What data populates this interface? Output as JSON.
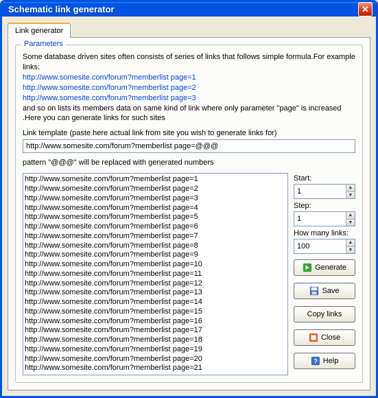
{
  "window": {
    "title": "Schematic link generator"
  },
  "tabs": {
    "main": "Link generator"
  },
  "params": {
    "legend": "Parameters",
    "intro": "Some database driven sites often consists of series of links that follows simple formula.For example links:",
    "example1": "http://www.somesite.com/forum?memberlist page=1",
    "example2": "http://www.somesite.com/forum?memberlist page=2",
    "example3": "http://www.somesite.com/forum?memberlist page=3",
    "explain": "and so on lists its members data on same kind of link where only parameter \"page\" is increased .Here you can generate links for such sites",
    "template_label": "Link template (paste here actual link from site you wish to generate links for)",
    "template_value": "http://www.somesite.com/forum?memberlist page=@@@",
    "pattern_note": "pattern \"@@@\" will be replaced with generated numbers"
  },
  "side": {
    "start_label": "Start:",
    "start_value": "1",
    "step_label": "Step:",
    "step_value": "1",
    "count_label": "How many links:",
    "count_value": "100",
    "generate": "Generate",
    "save": "Save",
    "copy": "Copy links",
    "close": "Close",
    "help": "Help"
  },
  "links": [
    "http://www.somesite.com/forum?memberlist page=1",
    "http://www.somesite.com/forum?memberlist page=2",
    "http://www.somesite.com/forum?memberlist page=3",
    "http://www.somesite.com/forum?memberlist page=4",
    "http://www.somesite.com/forum?memberlist page=5",
    "http://www.somesite.com/forum?memberlist page=6",
    "http://www.somesite.com/forum?memberlist page=7",
    "http://www.somesite.com/forum?memberlist page=8",
    "http://www.somesite.com/forum?memberlist page=9",
    "http://www.somesite.com/forum?memberlist page=10",
    "http://www.somesite.com/forum?memberlist page=11",
    "http://www.somesite.com/forum?memberlist page=12",
    "http://www.somesite.com/forum?memberlist page=13",
    "http://www.somesite.com/forum?memberlist page=14",
    "http://www.somesite.com/forum?memberlist page=15",
    "http://www.somesite.com/forum?memberlist page=16",
    "http://www.somesite.com/forum?memberlist page=17",
    "http://www.somesite.com/forum?memberlist page=18",
    "http://www.somesite.com/forum?memberlist page=19",
    "http://www.somesite.com/forum?memberlist page=20",
    "http://www.somesite.com/forum?memberlist page=21"
  ]
}
